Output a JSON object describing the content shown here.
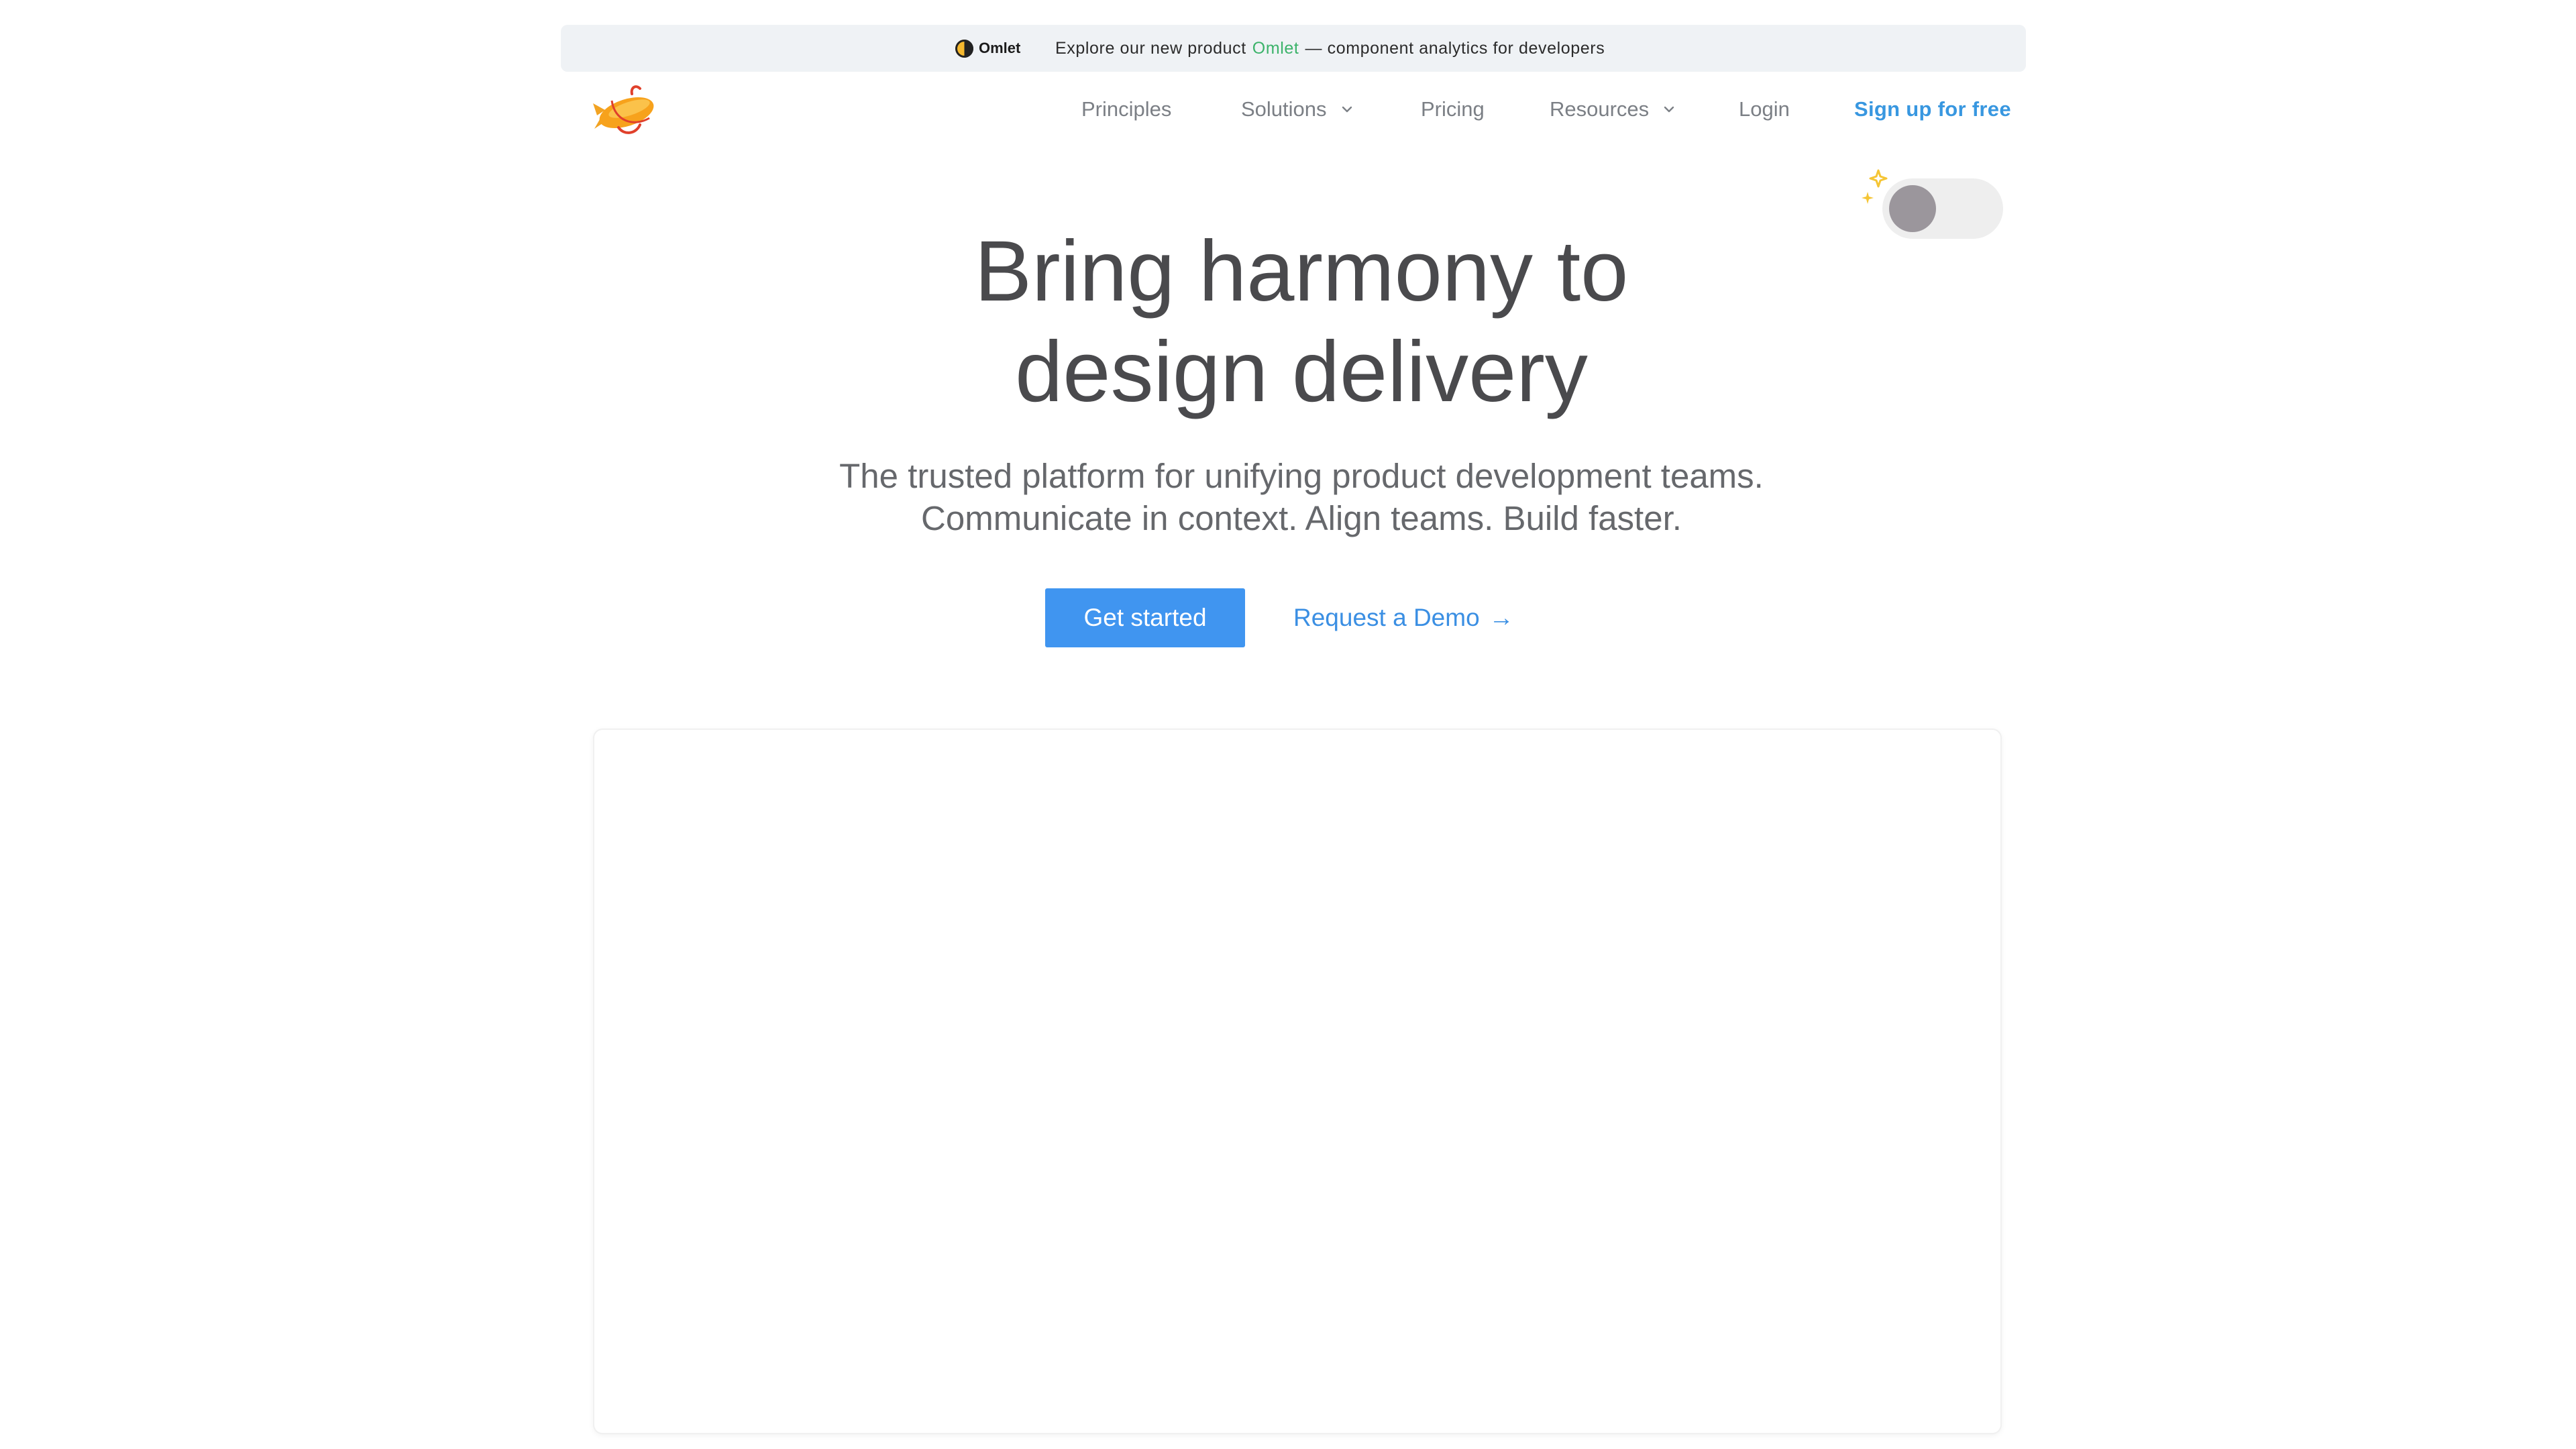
{
  "announcement": {
    "brand": "Omlet",
    "prefix": "Explore our new product",
    "highlight": "Omlet",
    "suffix": "— component analytics for developers",
    "highlight_color": "#3cb36a"
  },
  "header": {
    "logo_icon": "zeplin-blimp-logo",
    "nav": {
      "principles": "Principles",
      "solutions": "Solutions",
      "pricing": "Pricing",
      "resources": "Resources",
      "login": "Login",
      "signup": "Sign up for free"
    },
    "dropdown_icon": "chevron-down-icon"
  },
  "theme_toggle": {
    "icon": "sparkles-icon",
    "state": "off"
  },
  "hero": {
    "title_line1": "Bring harmony to",
    "title_line2": "design delivery",
    "subtitle_line1": "The trusted platform for unifying product development teams.",
    "subtitle_line2": "Communicate in context. Align teams. Build faster.",
    "primary_cta": "Get started",
    "secondary_cta": "Request a Demo",
    "secondary_cta_arrow": "→"
  },
  "colors": {
    "accent": "#4095f0",
    "link": "#3b8fe3",
    "text_dark": "#4a4a4d",
    "nav_text": "#7b7f85",
    "announce_bg": "#eff2f5"
  }
}
